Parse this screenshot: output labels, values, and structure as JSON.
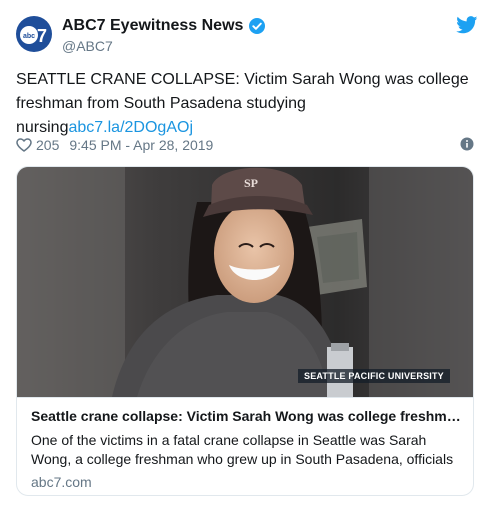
{
  "account": {
    "display_name": "ABC7 Eyewitness News",
    "handle": "@ABC7",
    "logo_text": "abc",
    "logo_number": "7"
  },
  "tweet": {
    "text": "SEATTLE CRANE COLLAPSE: Victim Sarah Wong was college freshman from South Pasadena studying nursing",
    "link": "abc7.la/2DOgAOj",
    "likes": "205",
    "timestamp": "9:45 PM - Apr 28, 2019"
  },
  "card": {
    "image_caption": "SEATTLE PACIFIC UNIVERSITY",
    "cap_text": "SP",
    "title": "Seattle crane collapse: Victim Sarah Wong was college freshman from South Pasadena",
    "description": "One of the victims in a fatal crane collapse in Seattle was Sarah Wong, a college freshman who grew up in South Pasadena, officials",
    "domain": "abc7.com"
  },
  "icons": {
    "verified": "verified-badge-icon",
    "bird": "twitter-bird-icon",
    "heart": "heart-icon",
    "info": "info-icon"
  },
  "colors": {
    "link": "#1b95e0",
    "verified": "#1da1f2",
    "muted": "#657786",
    "border": "#e1e8ed"
  }
}
